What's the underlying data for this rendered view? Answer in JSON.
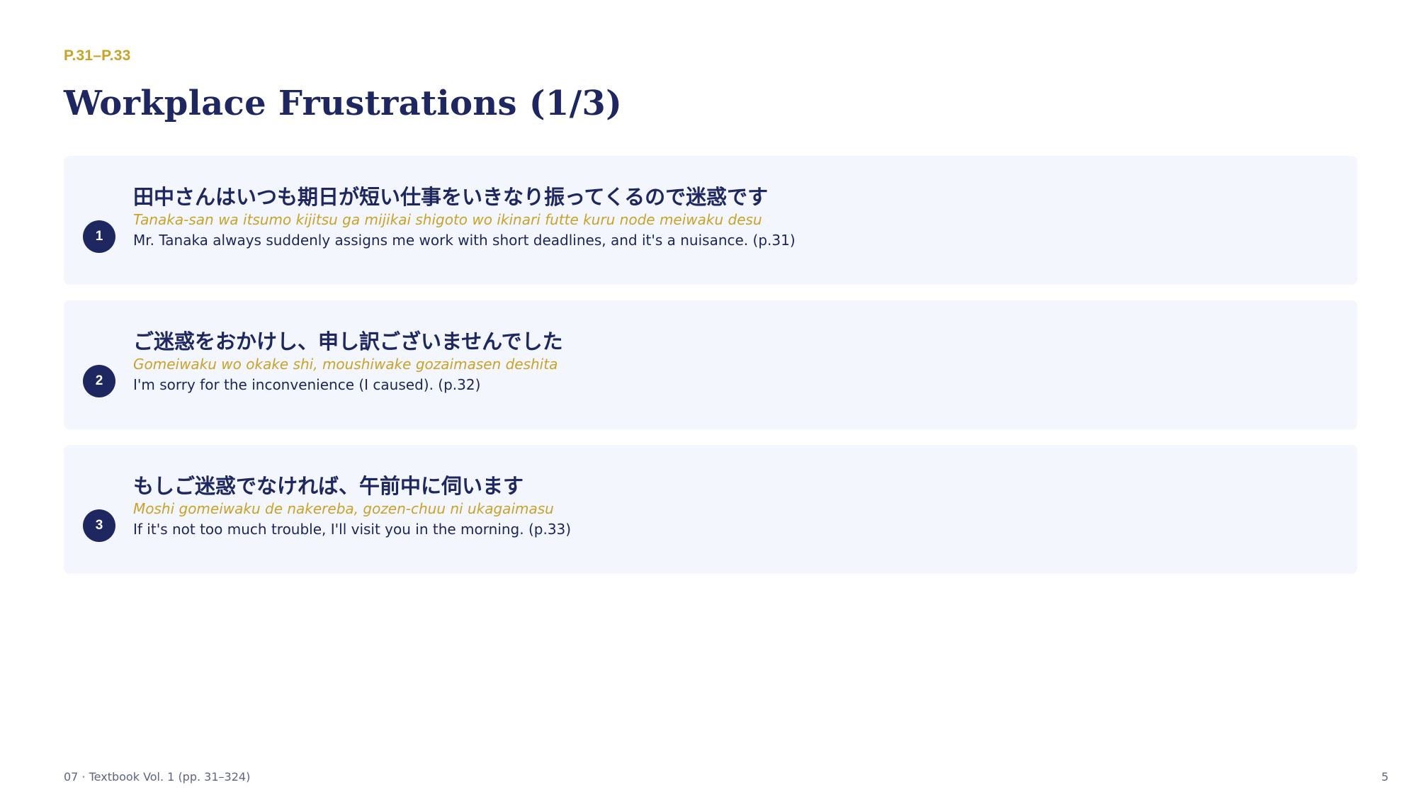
{
  "header": {
    "page_range": "P.31–P.33",
    "title": "Workplace Frustrations (1/3)"
  },
  "items": [
    {
      "number": "1",
      "japanese": "田中さんはいつも期日が短い仕事をいきなり振ってくるので迷惑です",
      "romaji": "Tanaka-san wa itsumo kijitsu ga mijikai shigoto wo ikinari futte kuru node meiwaku desu",
      "english": "Mr. Tanaka always suddenly assigns me work with short deadlines, and it's a nuisance. (p.31)"
    },
    {
      "number": "2",
      "japanese": "ご迷惑をおかけし、申し訳ございませんでした",
      "romaji": "Gomeiwaku wo okake shi, moushiwake gozaimasen deshita",
      "english": "I'm sorry for the inconvenience (I caused). (p.32)"
    },
    {
      "number": "3",
      "japanese": "もしご迷惑でなければ、午前中に伺います",
      "romaji": "Moshi gomeiwaku de nakereba, gozen-chuu ni ukagaimasu",
      "english": "If it's not too much trouble, I'll visit you in the morning. (p.33)"
    }
  ],
  "footer": {
    "source": "07 · Textbook Vol. 1 (pp. 31–324)",
    "page_number": "5"
  },
  "colors": {
    "navy": "#1f2760",
    "gold": "#c9a22a",
    "card_background": "#f3f7fd"
  }
}
